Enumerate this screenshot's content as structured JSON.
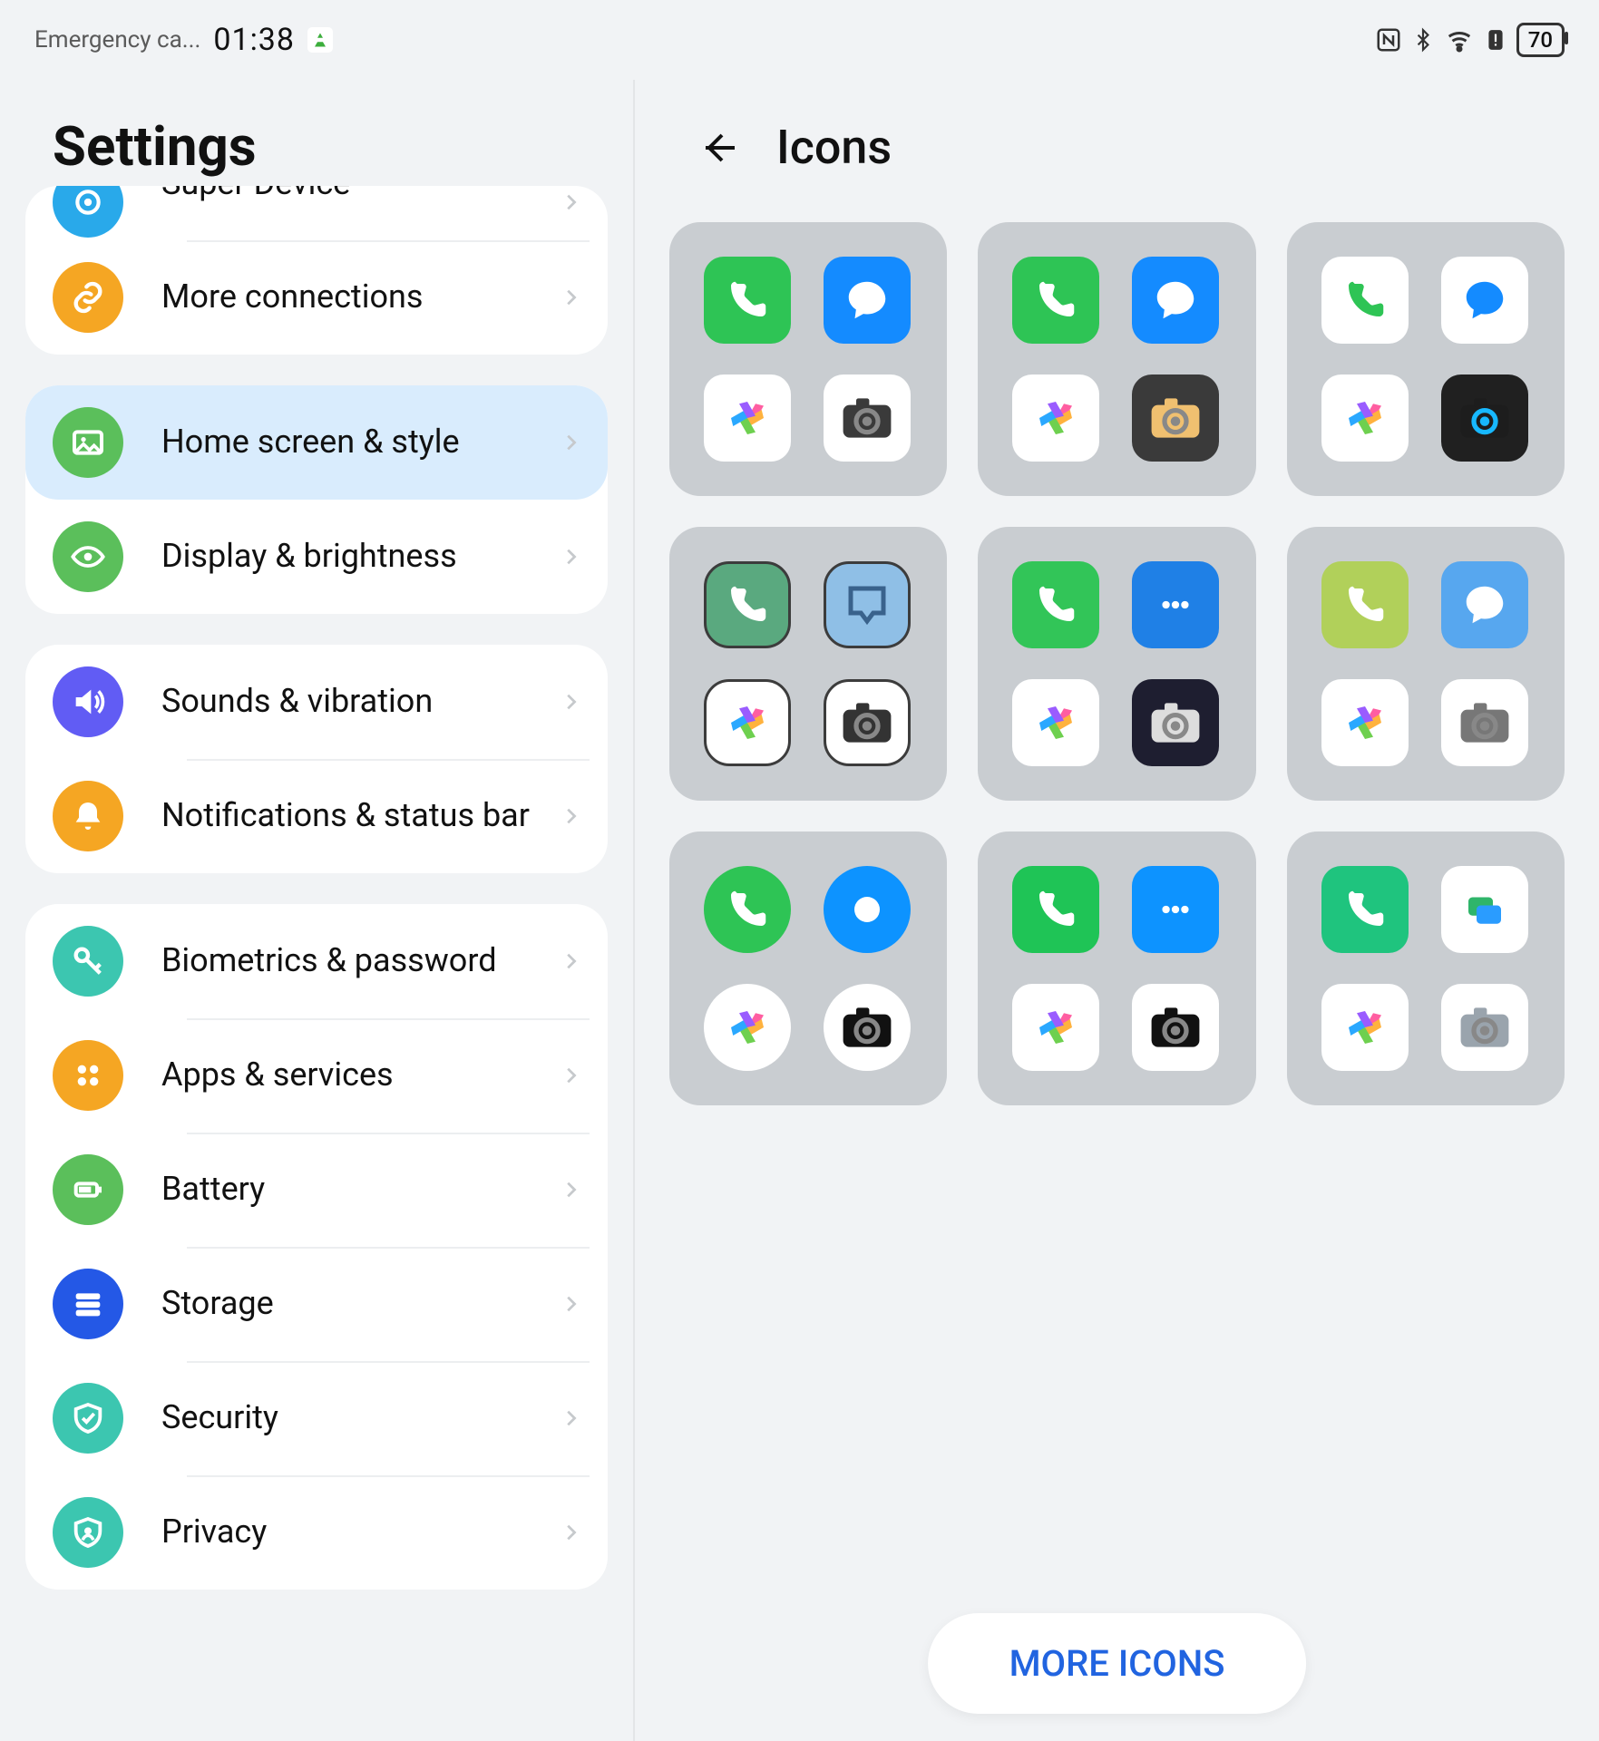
{
  "status_bar": {
    "emergency_text": "Emergency ca...",
    "time": "01:38",
    "battery": "70"
  },
  "settings": {
    "title": "Settings",
    "groups": [
      {
        "rows": [
          {
            "id": "super-device",
            "label": "Super Device",
            "icon": "device",
            "color": "ic-blue",
            "cut": true
          },
          {
            "id": "more-connections",
            "label": "More connections",
            "icon": "link",
            "color": "ic-orange"
          }
        ]
      },
      {
        "rows": [
          {
            "id": "home-style",
            "label": "Home screen & style",
            "icon": "image",
            "color": "ic-green",
            "selected": true
          },
          {
            "id": "display",
            "label": "Display & brightness",
            "icon": "eye",
            "color": "ic-green"
          }
        ]
      },
      {
        "rows": [
          {
            "id": "sounds",
            "label": "Sounds & vibration",
            "icon": "sound",
            "color": "ic-purple"
          },
          {
            "id": "notifications",
            "label": "Notifications & status bar",
            "icon": "bell",
            "color": "ic-orange"
          }
        ]
      },
      {
        "rows": [
          {
            "id": "biometrics",
            "label": "Biometrics & password",
            "icon": "key",
            "color": "ic-teal"
          },
          {
            "id": "apps",
            "label": "Apps & services",
            "icon": "grid",
            "color": "ic-orange"
          },
          {
            "id": "battery",
            "label": "Battery",
            "icon": "battery",
            "color": "ic-green"
          },
          {
            "id": "storage",
            "label": "Storage",
            "icon": "storage",
            "color": "ic-dblue"
          },
          {
            "id": "security",
            "label": "Security",
            "icon": "shield",
            "color": "ic-teal"
          },
          {
            "id": "privacy",
            "label": "Privacy",
            "icon": "privacy",
            "color": "ic-teal"
          }
        ]
      }
    ]
  },
  "icons_page": {
    "title": "Icons",
    "more_label": "MORE ICONS",
    "packs": [
      {
        "style": "rounded",
        "phone": "#2ec455",
        "chat": "#148bff",
        "gallery": "#ffffff",
        "camera": "#ffffff",
        "cam_body": "#3a3a3a",
        "chat_shape": "bubble"
      },
      {
        "style": "rounded",
        "phone": "#2ec455",
        "chat": "#148bff",
        "gallery": "#ffffff",
        "camera": "#3a3a3a",
        "cam_body": "#f0c070",
        "chat_shape": "bubble_g"
      },
      {
        "style": "rounded",
        "phone": "#ffffff",
        "chat": "#ffffff",
        "gallery": "#ffffff",
        "camera": "#202020",
        "cam_body": "#1d1d1d",
        "chat_shape": "plain",
        "phone_fg": "#2ec455",
        "chat_fg": "#148bff",
        "cam_ring": "#17b8ff"
      },
      {
        "style": "outline",
        "phone": "#5aa97f",
        "chat": "#8fbfe6",
        "gallery": "#ffffff",
        "camera": "#ffffff",
        "cam_body": "#333",
        "chat_shape": "outline"
      },
      {
        "style": "rounded",
        "phone": "#32c558",
        "chat": "#1f80e6",
        "gallery": "#ffffff",
        "camera": "#1e1e30",
        "cam_body": "#ddd",
        "chat_shape": "dots"
      },
      {
        "style": "rounded",
        "phone": "#b1d05a",
        "chat": "#57a7ef",
        "gallery": "#ffffff",
        "camera": "#ffffff",
        "cam_body": "#777",
        "chat_shape": "bubble_g",
        "phone_fg": "#fff"
      },
      {
        "style": "circle",
        "phone": "#2ec455",
        "chat": "#0d93ff",
        "gallery": "#ffffff",
        "camera": "#ffffff",
        "cam_body": "#111",
        "chat_shape": "solid_circle"
      },
      {
        "style": "rounded",
        "phone": "#1fc456",
        "chat": "#0d93ff",
        "gallery": "#ffffff",
        "camera": "#ffffff",
        "cam_body": "#111",
        "chat_shape": "dots_round"
      },
      {
        "style": "rounded",
        "phone": "#1fc47e",
        "chat": "#ffffff",
        "gallery": "#ffffff",
        "camera": "#ffffff",
        "cam_body": "#9aa4ad",
        "chat_shape": "layers",
        "chat_fg": "#2a9cff"
      }
    ]
  }
}
